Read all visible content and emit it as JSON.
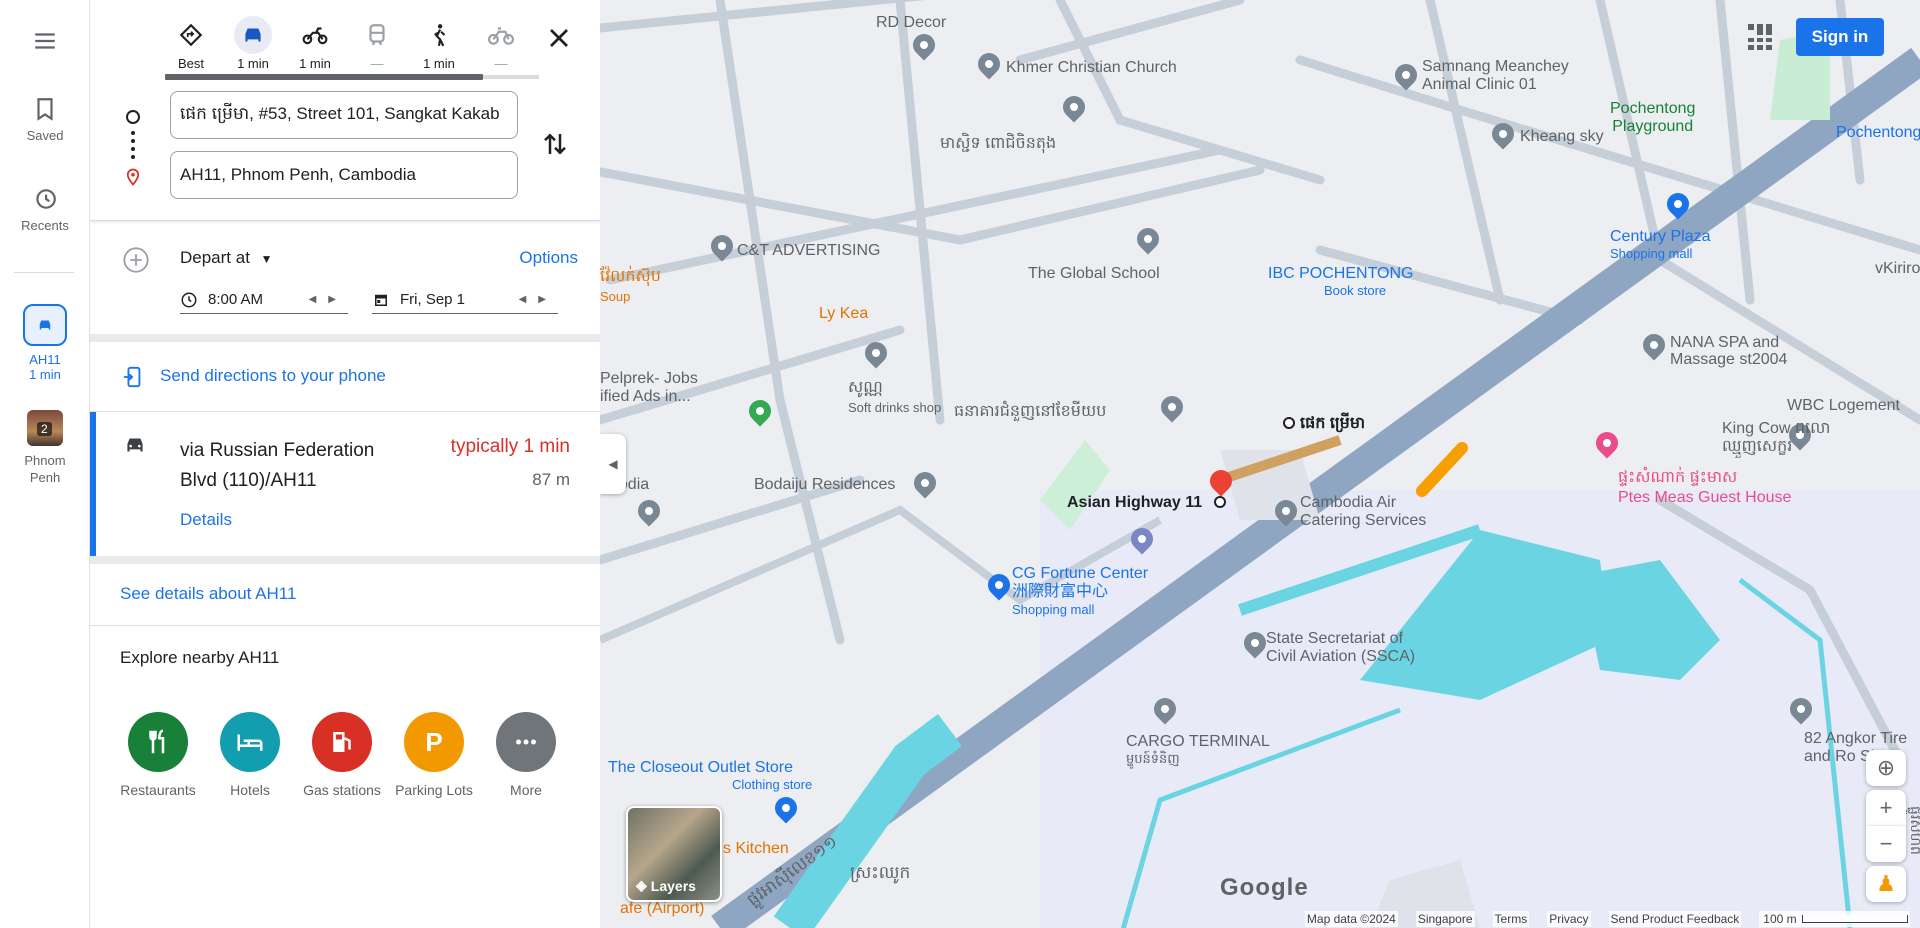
{
  "rail": {
    "saved": "Saved",
    "recents": "Recents",
    "recent1_line1": "AH11",
    "recent1_line2": "1 min",
    "recent2_badge": "2",
    "recent2_label": "Phnom Penh"
  },
  "modes": [
    {
      "icon": "diamond-directions-icon",
      "label": "Best"
    },
    {
      "icon": "car-icon",
      "label": "1 min"
    },
    {
      "icon": "motorcycle-icon",
      "label": "1 min"
    },
    {
      "icon": "transit-icon",
      "label": "—"
    },
    {
      "icon": "walking-icon",
      "label": "1 min"
    },
    {
      "icon": "bicycle-icon",
      "label": "—"
    }
  ],
  "origin_value": "ផេក ម្រើមា, #53, Street 101, Sangkat Kakab",
  "destination_value": "AH11, Phnom Penh, Cambodia",
  "depart_label": "Depart at",
  "options_label": "Options",
  "time_value": "8:00 AM",
  "date_value": "Fri, Sep 1",
  "send_label": "Send directions to your phone",
  "route": {
    "name": "via Russian Federation Blvd (110)/AH11",
    "time": "typically 1 min",
    "distance": "87 m",
    "details": "Details"
  },
  "see_details": "See details about AH11",
  "explore_title": "Explore nearby AH11",
  "categories": [
    {
      "label": "Restaurants",
      "color": "#188038",
      "icon": "restaurant-icon"
    },
    {
      "label": "Hotels",
      "color": "#129eaf",
      "icon": "hotel-icon"
    },
    {
      "label": "Gas stations",
      "color": "#d93025",
      "icon": "gas-station-icon"
    },
    {
      "label": "Parking Lots",
      "color": "#f29900",
      "icon": "parking-icon",
      "glyph": "P"
    },
    {
      "label": "More",
      "color": "#70757a",
      "icon": "more-icon"
    }
  ],
  "map": {
    "sign_in": "Sign in",
    "layers": "Layers",
    "google": "Google",
    "labels": {
      "rd_decor": "RD Decor",
      "khmer_church": "Khmer Christian Church",
      "samnang_line1": "Samnang Meanchey",
      "samnang_line2": "Animal Clinic 01",
      "pochentong_pg_line1": "Pochentong",
      "pochentong_pg_line2": "Playground",
      "pochentong": "Pochentong",
      "mosque_km": "មាស្ជិទ ពោជិចិនតុង",
      "kheang_sky": "Kheang sky",
      "ct_adv": "C&T ADVERTISING",
      "global_school": "The Global School",
      "century_plaza": "Century Plaza",
      "shopping_mall": "Shopping mall",
      "vkirirom": "vKiriror",
      "soup_km": "វ៉ែលក់ស៊ុប",
      "soup": "Soup",
      "ibc": "IBC POCHENTONG",
      "book_store": "Book store",
      "ly_kea": "Ly Kea",
      "nana_line1": "NANA SPA and",
      "nana_line2": "Massage st2004",
      "pelprek_line1": "Pelprek- Jobs",
      "pelprek_line2": "ified Ads in...",
      "soft_km": "សូណ្ណ",
      "soft_drinks": "Soft drinks shop",
      "bank_km": "ធនាគារជំនួញ​នៅ​ខែមីយប",
      "wbc": "WBC Logement",
      "start_marker": "ផេក ម្រើមា",
      "king_cow_line1": "King Cow ពលោ",
      "king_cow_line2": "ឈ្មួញសេក្ខរ",
      "bodia": "bodia",
      "bodaiju": "Bodaiju Residences",
      "asian_highway": "Asian Highway 11",
      "cac_line1": "Cambodia Air",
      "cac_line2": "Catering Services",
      "ptes_km": "ផ្ទះសំណាក់ ផ្ទះមាស",
      "ptes": "Ptes Meas Guest House",
      "cg_fortune": "CG Fortune Center",
      "cg_cn": "洲際財富中心",
      "cg_mall": "Shopping mall",
      "sscaa_line1": "State Secretariat of",
      "sscaa_line2": "Civil Aviation (SSCA)",
      "cargo": "CARGO TERMINAL",
      "cargo_km": "ម្ហូបន៍ទំនិញ",
      "angkor_line1": "82 Angkor Tire",
      "angkor_line2": "and Ro Sho",
      "closeout": "The Closeout Outlet Store",
      "clothing": "Clothing store",
      "kitchen": "s Kitchen",
      "road_km1": "ផ្លូវអាស៊ីលេខ១១",
      "road_km2": "ស្រះឈូក",
      "airport": "afe (Airport)",
      "side_km": "ផ្លូវសហព"
    },
    "footer": {
      "map_data": "Map data ©2024",
      "region": "Singapore",
      "terms": "Terms",
      "privacy": "Privacy",
      "feedback": "Send Product Feedback",
      "scale": "100 m"
    }
  }
}
